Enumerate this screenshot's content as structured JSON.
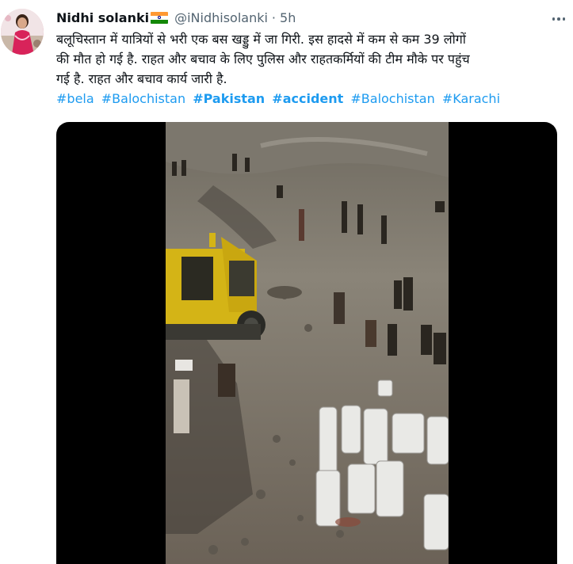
{
  "tweet": {
    "author_name": "Nidhi solanki",
    "handle": "@iNidhisolanki",
    "separator": "·",
    "time": "5h",
    "text_lines": [
      "बलूचिस्तान में यात्रियों से भरी एक बस खड्डु में जा गिरी. इस हादसे में कम से कम 39 लोगों",
      "की मौत हो गई है. राहत और बचाव के लिए पुलिस और राहतकर्मियों  की टीम मौके पर पहुंच",
      "गई है. राहत और बचाव कार्य जारी है."
    ],
    "hashtags": [
      {
        "text": "#bela",
        "bold": false
      },
      {
        "text": "#Balochistan",
        "bold": false
      },
      {
        "text": "#Pakistan",
        "bold": true
      },
      {
        "text": "#accident",
        "bold": true
      },
      {
        "text": "#Balochistan",
        "bold": false
      },
      {
        "text": "#Karachi",
        "bold": false
      }
    ]
  },
  "colors": {
    "link": "#1d9bf0",
    "secondary_text": "#536471",
    "primary_text": "#0f1419",
    "media_letterbox": "#000000"
  },
  "icons": {
    "flag": "india-flag-icon",
    "more": "more-options-icon"
  }
}
